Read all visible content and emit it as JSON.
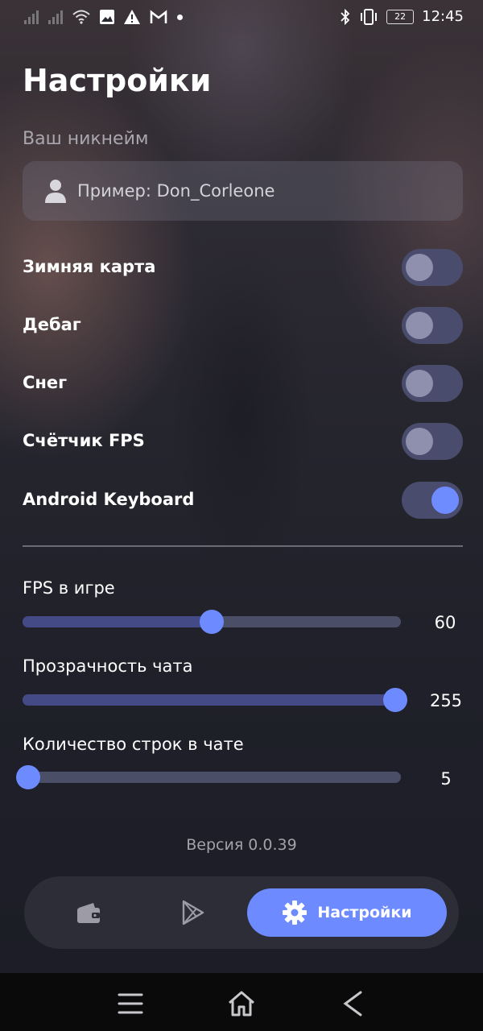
{
  "status_bar": {
    "time": "12:45",
    "battery_level": "22",
    "icons_left": [
      "signal-icon",
      "signal-icon",
      "wifi-icon",
      "image-icon",
      "warning-icon",
      "gmail-icon",
      "dot-icon"
    ],
    "icons_right": [
      "bluetooth-icon",
      "vibrate-icon",
      "battery-icon"
    ]
  },
  "page": {
    "title": "Настройки"
  },
  "nickname": {
    "label": "Ваш никнейм",
    "placeholder": "Пример: Don_Corleone",
    "value": ""
  },
  "toggles": [
    {
      "label": "Зимняя карта",
      "on": false
    },
    {
      "label": "Дебаг",
      "on": false
    },
    {
      "label": "Снег",
      "on": false
    },
    {
      "label": "Счётчик FPS",
      "on": false
    },
    {
      "label": "Android Keyboard",
      "on": true
    }
  ],
  "sliders": [
    {
      "label": "FPS в игре",
      "value": "60",
      "fraction": 0.5
    },
    {
      "label": "Прозрачность чата",
      "value": "255",
      "fraction": 1.0
    },
    {
      "label": "Количество строк в чате",
      "value": "5",
      "fraction": 0.0
    }
  ],
  "version": "Версия 0.0.39",
  "tab_bar": {
    "tabs": [
      {
        "icon": "wallet-icon",
        "label": ""
      },
      {
        "icon": "play-store-icon",
        "label": ""
      },
      {
        "icon": "gear-icon",
        "label": "Настройки",
        "active": true
      }
    ]
  },
  "colors": {
    "accent": "#6d8bff",
    "switch_track": "#4a4c6e",
    "background": "#1e1f27"
  }
}
